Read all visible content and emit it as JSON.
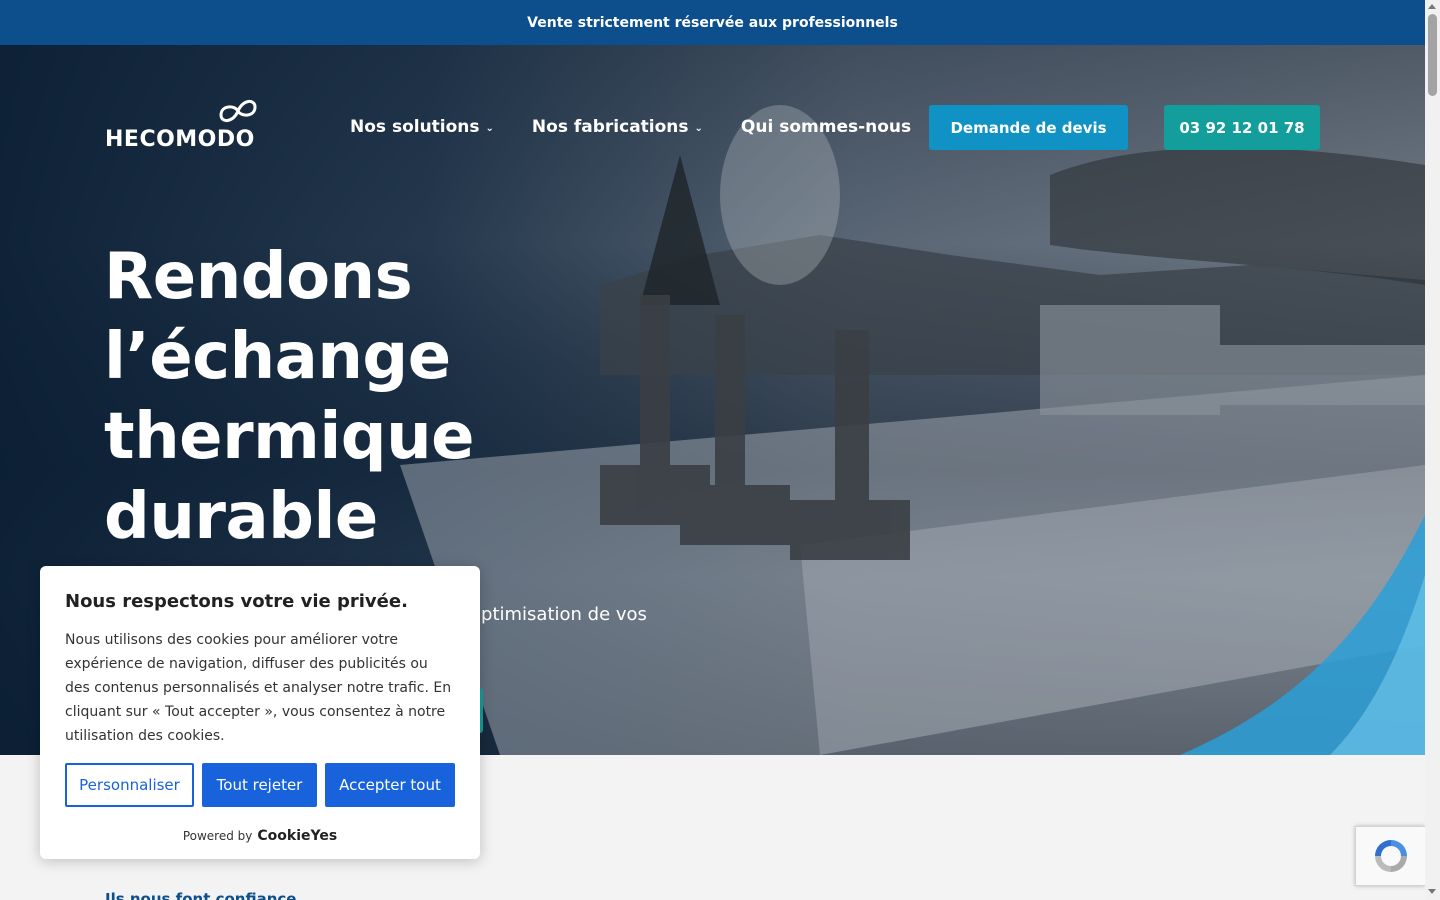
{
  "topbar": {
    "text": "Vente strictement réservée aux professionnels"
  },
  "header": {
    "logo_text": "HECOMODO",
    "nav": [
      {
        "label": "Nos solutions",
        "has_dropdown": true
      },
      {
        "label": "Nos fabrications",
        "has_dropdown": true
      },
      {
        "label": "Qui sommes-nous",
        "has_dropdown": false
      }
    ],
    "quote_button": "Demande de devis",
    "phone_button": "03 92 12 01 78"
  },
  "hero": {
    "title_lines": [
      "Rendons",
      "l’échange",
      "thermique",
      "durable"
    ],
    "subtitle_visible": "optimisation de vos"
  },
  "trust_link": "Ils nous font confiance",
  "cookie_banner": {
    "title": "Nous respectons votre vie privée.",
    "text": "Nous utilisons des cookies pour améliorer votre expérience de navigation, diffuser des publicités ou des contenus personnalisés et analyser notre trafic. En cliquant sur « Tout accepter », vous consentez à notre utilisation des cookies.",
    "customize_button": "Personnaliser",
    "reject_button": "Tout rejeter",
    "accept_button": "Accepter tout",
    "powered_by": "Powered by",
    "brand": "CookieYes"
  },
  "colors": {
    "topbar": "#0d4e8c",
    "devis": "#1192c4",
    "phone": "#139e9b",
    "cookie_primary": "#1863dc"
  }
}
